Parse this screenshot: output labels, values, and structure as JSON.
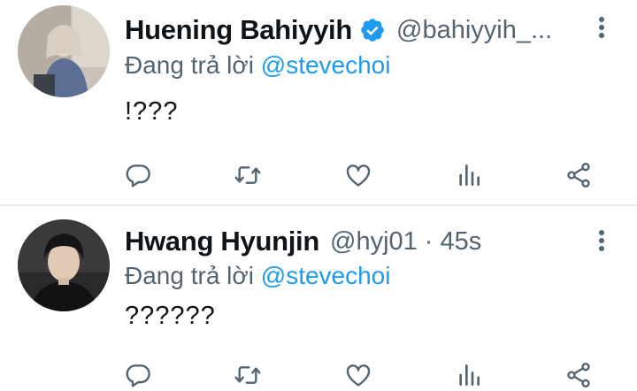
{
  "tweets": [
    {
      "name": "Huening Bahiyyih",
      "verified": true,
      "handle": "@bahiyyih_...",
      "time": "",
      "replying_prefix": "Đang trả lời",
      "replying_to": "@stevechoi",
      "text": "!???",
      "avatar_icon": "profile-photo",
      "actions": [
        "reply-icon",
        "retweet-icon",
        "like-icon",
        "stats-icon",
        "share-icon"
      ]
    },
    {
      "name": "Hwang Hyunjin",
      "verified": false,
      "handle": "@hyj01",
      "separator": "·",
      "time": "45s",
      "replying_prefix": "Đang trả lời",
      "replying_to": "@stevechoi",
      "text": "??????",
      "avatar_icon": "profile-photo",
      "actions": [
        "reply-icon",
        "retweet-icon",
        "like-icon",
        "stats-icon",
        "share-icon"
      ]
    }
  ],
  "colors": {
    "accent": "#1d9bf0",
    "secondary_text": "#536471",
    "primary_text": "#0f1419",
    "divider": "#e7ecf0"
  }
}
